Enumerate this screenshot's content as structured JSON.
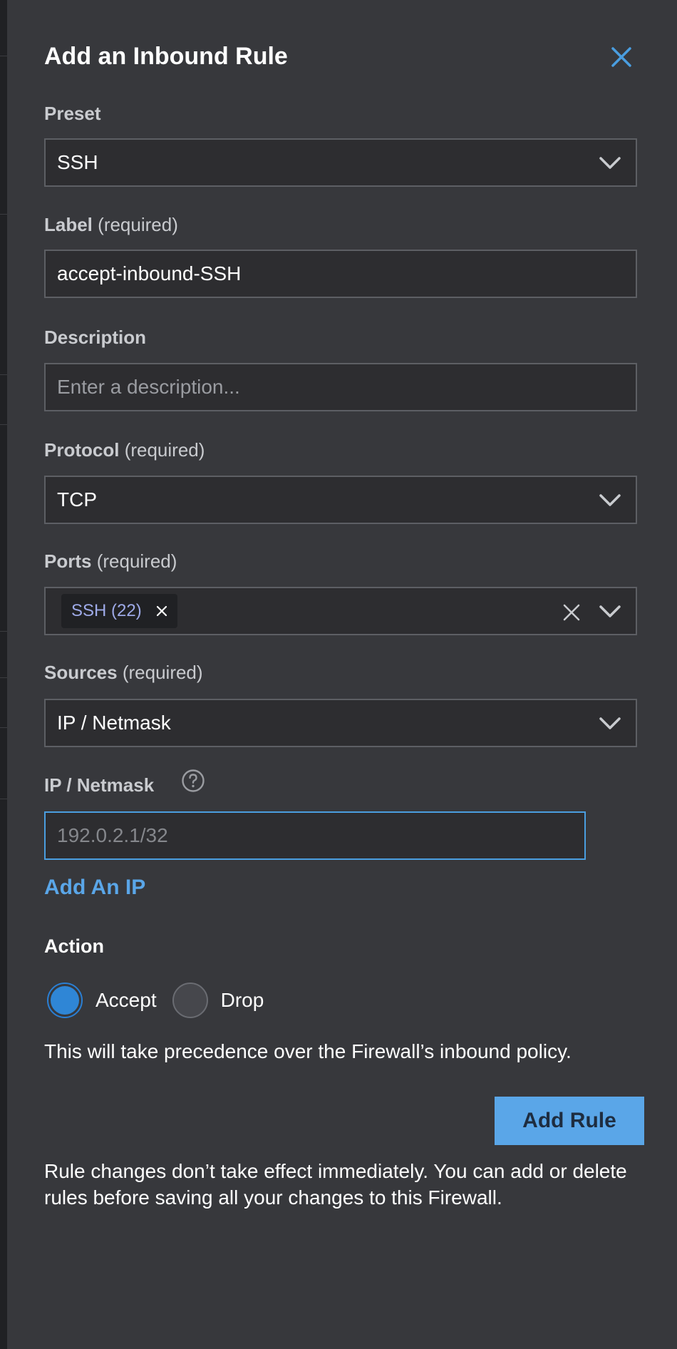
{
  "drawer": {
    "title": "Add an Inbound Rule",
    "accent_color": "#5aa6e8"
  },
  "preset": {
    "label": "Preset",
    "value": "SSH"
  },
  "label_field": {
    "label": "Label",
    "required": "(required)",
    "value": "accept-inbound-SSH"
  },
  "description": {
    "label": "Description",
    "placeholder": "Enter a description..."
  },
  "protocol": {
    "label": "Protocol",
    "required": "(required)",
    "value": "TCP"
  },
  "ports": {
    "label": "Ports",
    "required": "(required)",
    "chips": [
      "SSH (22)"
    ]
  },
  "sources": {
    "label": "Sources",
    "required": "(required)",
    "value": "IP / Netmask"
  },
  "ip_netmask": {
    "label": "IP / Netmask",
    "placeholder": "192.0.2.1/32",
    "add_label": "Add An IP"
  },
  "action": {
    "label": "Action",
    "options": [
      {
        "label": "Accept",
        "checked": true
      },
      {
        "label": "Drop",
        "checked": false
      }
    ],
    "note": "This will take precedence over the Firewall’s inbound policy."
  },
  "submit_label": "Add Rule",
  "footer_note": "Rule changes don’t take effect immediately. You can add or delete rules before saving all your changes to this Firewall."
}
